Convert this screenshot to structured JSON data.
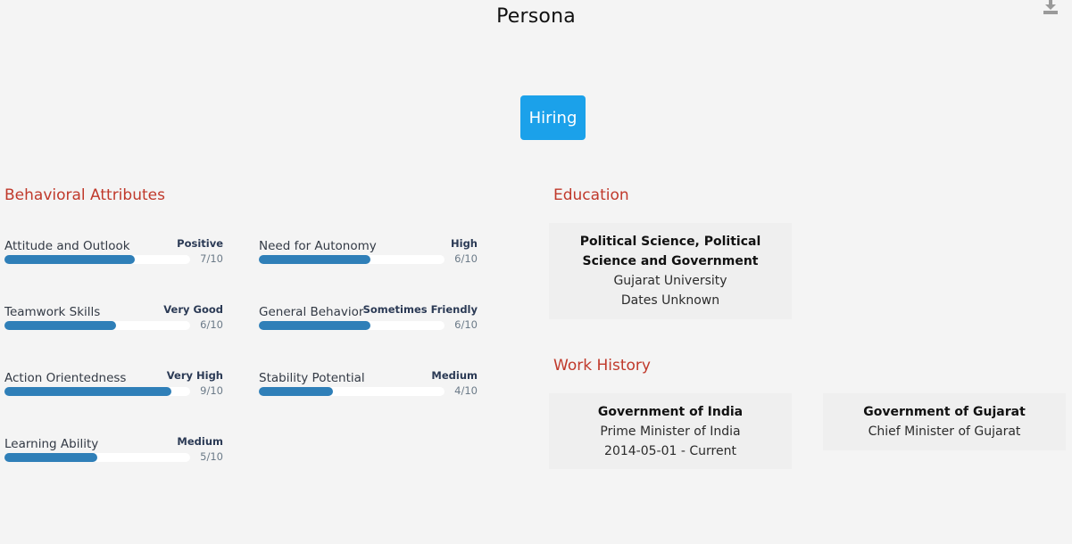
{
  "header": {
    "title": "Persona",
    "download_icon": "download-icon"
  },
  "mode_button": {
    "label": "Hiring",
    "color": "#1ba1ea"
  },
  "behavioral": {
    "heading": "Behavioral Attributes",
    "heading_color": "#c0392b",
    "bar_color": "#2f7fb8",
    "attributes": [
      {
        "label": "Attitude and Outlook",
        "level": "Positive",
        "score": "7/10",
        "value": 7
      },
      {
        "label": "Need for Autonomy",
        "level": "High",
        "score": "6/10",
        "value": 6
      },
      {
        "label": "Teamwork Skills",
        "level": "Very Good",
        "score": "6/10",
        "value": 6
      },
      {
        "label": "General Behavior",
        "level": "Sometimes Friendly",
        "score": "6/10",
        "value": 6
      },
      {
        "label": "Action Orientedness",
        "level": "Very High",
        "score": "9/10",
        "value": 9
      },
      {
        "label": "Stability Potential",
        "level": "Medium",
        "score": "4/10",
        "value": 4
      },
      {
        "label": "Learning Ability",
        "level": "Medium",
        "score": "5/10",
        "value": 5
      }
    ]
  },
  "education": {
    "heading": "Education",
    "items": [
      {
        "degree": "Political Science, Political Science and Government",
        "school": "Gujarat University",
        "dates": "Dates Unknown"
      }
    ]
  },
  "work_history": {
    "heading": "Work History",
    "items": [
      {
        "organization": "Government of India",
        "role": "Prime Minister of India",
        "dates": "2014-05-01 - Current"
      },
      {
        "organization": "Government of Gujarat",
        "role": "Chief Minister of Gujarat"
      }
    ]
  }
}
